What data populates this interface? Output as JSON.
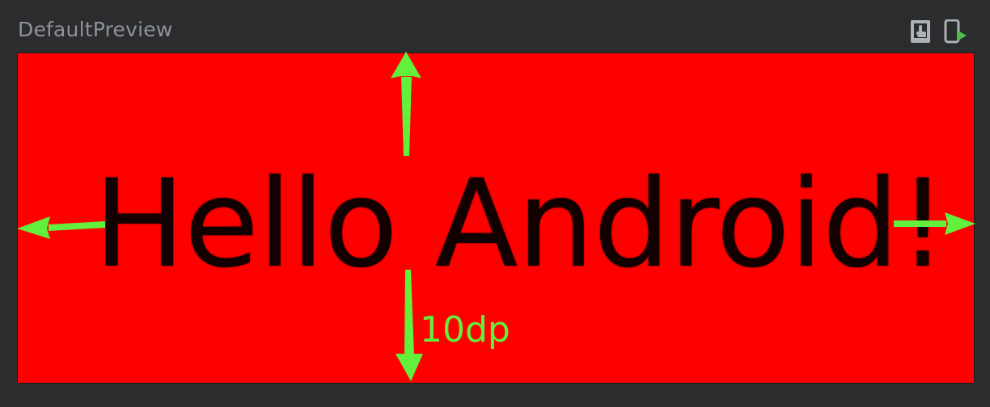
{
  "panel": {
    "title": "DefaultPreview"
  },
  "toolbar": {
    "interactive_icon": "interactive-mode-icon",
    "deploy_icon": "deploy-to-device-icon"
  },
  "preview": {
    "background_color": "#ff0000",
    "text": "Hello Android!",
    "text_color": "#000000"
  },
  "annotation": {
    "padding_label": "10dp",
    "arrow_color": "#62f03c"
  }
}
